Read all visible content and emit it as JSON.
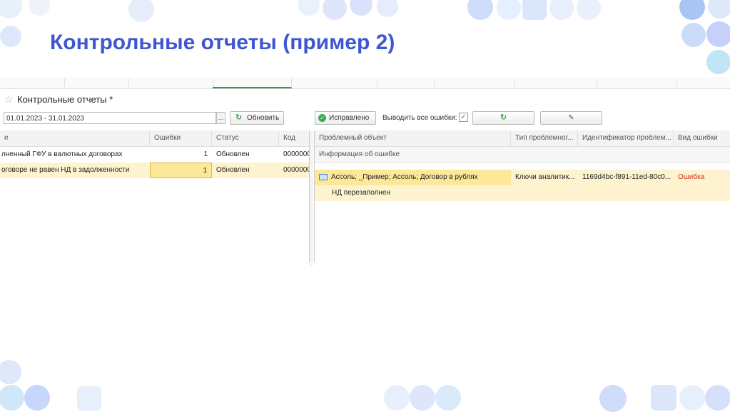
{
  "slide": {
    "title": "Контрольные отчеты (пример 2)"
  },
  "form": {
    "title": "Контрольные отчеты *",
    "period": "01.01.2023 - 31.01.2023",
    "period_select": "...",
    "refresh_label": "Обновить",
    "fixed_label": "Исправлено",
    "show_all_errors_label": "Выводить все ошибки:",
    "show_all_errors_checked": true
  },
  "left_grid": {
    "columns": [
      "е",
      "Ошибки",
      "Статус",
      "Код"
    ],
    "rows": [
      {
        "name": "лненный ГФУ в валютных договорах",
        "errors": "1",
        "status": "Обновлен",
        "code": "0000000"
      },
      {
        "name": "оговоре не равен НД в задолженности",
        "errors": "1",
        "status": "Обновлен",
        "code": "0000000"
      }
    ]
  },
  "right_grid": {
    "columns": [
      "Проблемный объект",
      "Тип проблемног...",
      "Идентификатор проблем...",
      "Вид ошибки"
    ],
    "subheader": "Информация об ошибке",
    "row": {
      "object": "Ассоль; _Пример; Ассоль; Договор в рублях",
      "type": "Ключи аналитик...",
      "id": "1169d4bc-f891-11ed-80c0...",
      "kind": "Ошибка"
    },
    "detail": "НД перезаполнен"
  },
  "colors": {
    "accent": "#3f56d1",
    "selection": "#fdf3cf",
    "error": "#d8321e",
    "ok": "#3aad53"
  }
}
